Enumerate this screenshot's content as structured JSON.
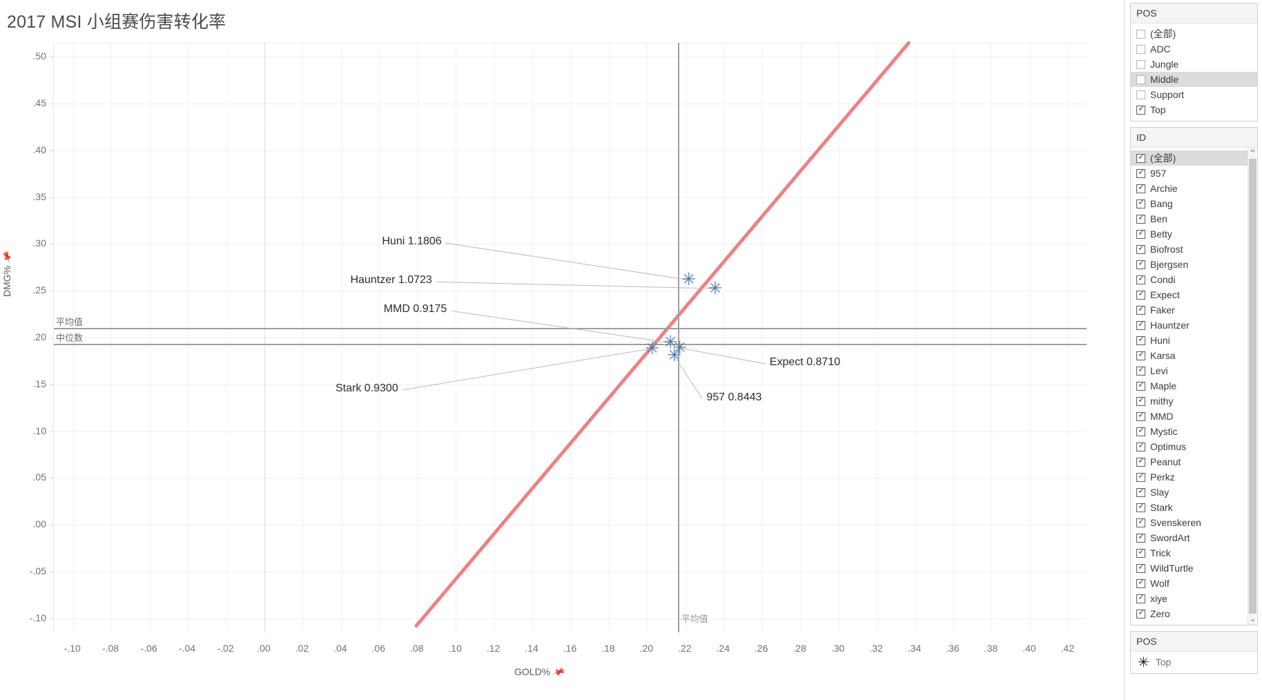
{
  "chart_title": "2017 MSI 小组赛伤害转化率",
  "axes": {
    "x_title": "GOLD%",
    "y_title": "DMG%",
    "pin_icon": "pin-icon",
    "x_ticks": [
      "-.10",
      "-.08",
      "-.06",
      "-.04",
      "-.02",
      ".00",
      ".02",
      ".04",
      ".06",
      ".08",
      ".10",
      ".12",
      ".14",
      ".16",
      ".18",
      ".20",
      ".22",
      ".24",
      ".26",
      ".28",
      ".30",
      ".32",
      ".34",
      ".36",
      ".38",
      ".40",
      ".42"
    ],
    "y_ticks": [
      ".50",
      ".45",
      ".40",
      ".35",
      ".30",
      ".25",
      ".20",
      ".15",
      ".10",
      ".05",
      ".00",
      "-.05",
      "-.10"
    ]
  },
  "reference_lines": {
    "y_mean_label": "平均值",
    "y_median_label": "中位数",
    "x_mean_label": "平均值"
  },
  "chart_data": {
    "type": "scatter",
    "title": "2017 MSI 小组赛伤害转化率",
    "xlabel": "GOLD%",
    "ylabel": "DMG%",
    "xlim": [
      -0.11,
      0.43
    ],
    "ylim": [
      -0.115,
      0.515
    ],
    "grid": true,
    "legend_position": "right-bottom",
    "series": [
      {
        "name": "Top",
        "marker": "asterisk",
        "color": "#4a7aa7",
        "points": [
          {
            "label": "Huni",
            "ratio": "1.1806",
            "x": 0.2216,
            "y": 0.2616
          },
          {
            "label": "Hauntzer",
            "ratio": "1.0723",
            "x": 0.2354,
            "y": 0.2524
          },
          {
            "label": "MMD",
            "ratio": "0.9175",
            "x": 0.212,
            "y": 0.1945
          },
          {
            "label": "Stark",
            "ratio": "0.9300",
            "x": 0.2025,
            "y": 0.1884
          },
          {
            "label": "Expect",
            "ratio": "0.8710",
            "x": 0.2169,
            "y": 0.1889
          },
          {
            "label": "957",
            "ratio": "0.8443",
            "x": 0.214,
            "y": 0.1807
          }
        ]
      }
    ],
    "trend_line": {
      "color": "#ef8081",
      "x0": 0.0795,
      "y0": -0.108,
      "x1": 0.337,
      "y1": 0.515
    },
    "reference_lines": {
      "y_mean": 0.21,
      "y_median": 0.193,
      "x_mean": 0.216
    },
    "annotations": [
      {
        "text": "Huni 1.1806",
        "x": 0.0925,
        "y": 0.301
      },
      {
        "text": "Hauntzer 1.0723",
        "x": 0.0875,
        "y": 0.2595
      },
      {
        "text": "MMD 0.9175",
        "x": 0.0955,
        "y": 0.2285
      },
      {
        "text": "Stark 0.9300",
        "x": 0.07,
        "y": 0.144
      },
      {
        "text": "Expect 0.8710",
        "x": 0.264,
        "y": 0.172
      },
      {
        "text": "957  0.8443",
        "x": 0.231,
        "y": 0.1345
      }
    ]
  },
  "sidebar": {
    "pos_filter": {
      "header": "POS",
      "items": [
        {
          "label": "(全部)",
          "checked": false,
          "hover": false
        },
        {
          "label": "ADC",
          "checked": false,
          "hover": false
        },
        {
          "label": "Jungle",
          "checked": false,
          "hover": false
        },
        {
          "label": "Middle",
          "checked": false,
          "hover": true
        },
        {
          "label": "Support",
          "checked": false,
          "hover": false
        },
        {
          "label": "Top",
          "checked": true,
          "hover": false
        }
      ]
    },
    "id_filter": {
      "header": "ID",
      "items": [
        {
          "label": "(全部)",
          "checked": true,
          "hover": true
        },
        {
          "label": "957",
          "checked": true,
          "hover": false
        },
        {
          "label": "Archie",
          "checked": true,
          "hover": false
        },
        {
          "label": "Bang",
          "checked": true,
          "hover": false
        },
        {
          "label": "Ben",
          "checked": true,
          "hover": false
        },
        {
          "label": "Betty",
          "checked": true,
          "hover": false
        },
        {
          "label": "Biofrost",
          "checked": true,
          "hover": false
        },
        {
          "label": "Bjergsen",
          "checked": true,
          "hover": false
        },
        {
          "label": "Condi",
          "checked": true,
          "hover": false
        },
        {
          "label": "Expect",
          "checked": true,
          "hover": false
        },
        {
          "label": "Faker",
          "checked": true,
          "hover": false
        },
        {
          "label": "Hauntzer",
          "checked": true,
          "hover": false
        },
        {
          "label": "Huni",
          "checked": true,
          "hover": false
        },
        {
          "label": "Karsa",
          "checked": true,
          "hover": false
        },
        {
          "label": "Levi",
          "checked": true,
          "hover": false
        },
        {
          "label": "Maple",
          "checked": true,
          "hover": false
        },
        {
          "label": "mithy",
          "checked": true,
          "hover": false
        },
        {
          "label": "MMD",
          "checked": true,
          "hover": false
        },
        {
          "label": "Mystic",
          "checked": true,
          "hover": false
        },
        {
          "label": "Optimus",
          "checked": true,
          "hover": false
        },
        {
          "label": "Peanut",
          "checked": true,
          "hover": false
        },
        {
          "label": "Perkz",
          "checked": true,
          "hover": false
        },
        {
          "label": "Slay",
          "checked": true,
          "hover": false
        },
        {
          "label": "Stark",
          "checked": true,
          "hover": false
        },
        {
          "label": "Svenskeren",
          "checked": true,
          "hover": false
        },
        {
          "label": "SwordArt",
          "checked": true,
          "hover": false
        },
        {
          "label": "Trick",
          "checked": true,
          "hover": false
        },
        {
          "label": "WildTurtle",
          "checked": true,
          "hover": false
        },
        {
          "label": "Wolf",
          "checked": true,
          "hover": false
        },
        {
          "label": "xiye",
          "checked": true,
          "hover": false
        },
        {
          "label": "Zero",
          "checked": true,
          "hover": false
        }
      ],
      "scroll_up_icon": "chevron-up-icon",
      "scroll_down_icon": "chevron-down-icon"
    },
    "legend": {
      "header": "POS",
      "items": [
        {
          "label": "Top",
          "mark": "asterisk-marker"
        }
      ]
    }
  },
  "colors": {
    "marker": "#4a7aa7",
    "trend": "#ef8081",
    "reference": "#9e9e9e",
    "grid": "#efefef"
  }
}
